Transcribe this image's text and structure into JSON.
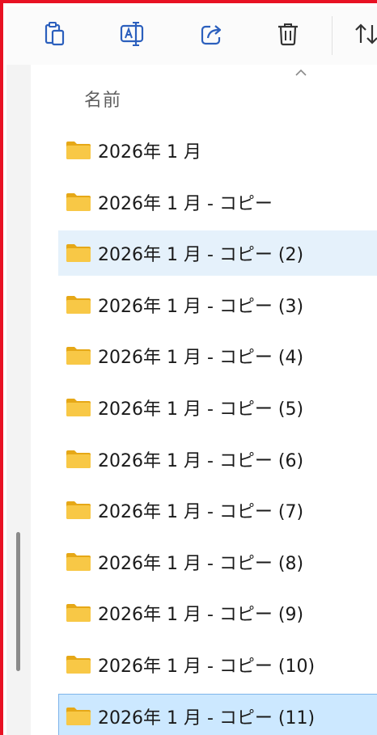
{
  "toolbar": {
    "buttons": [
      {
        "name": "paste-button",
        "icon": "clipboard-icon"
      },
      {
        "name": "rename-button",
        "icon": "rename-icon"
      },
      {
        "name": "share-button",
        "icon": "share-icon"
      },
      {
        "name": "delete-button",
        "icon": "trash-icon"
      },
      {
        "name": "sort-button",
        "icon": "sort-icon"
      }
    ]
  },
  "column_header": {
    "name_label": "名前",
    "sort_icon": "chevron-up-icon"
  },
  "files": [
    {
      "label": "2026年 1 月",
      "state": "normal"
    },
    {
      "label": "2026年 1 月 - コピー",
      "state": "normal"
    },
    {
      "label": "2026年 1 月 - コピー (2)",
      "state": "hover"
    },
    {
      "label": "2026年 1 月 - コピー (3)",
      "state": "normal"
    },
    {
      "label": "2026年 1 月 - コピー (4)",
      "state": "normal"
    },
    {
      "label": "2026年 1 月 - コピー (5)",
      "state": "normal"
    },
    {
      "label": "2026年 1 月 - コピー (6)",
      "state": "normal"
    },
    {
      "label": "2026年 1 月 - コピー (7)",
      "state": "normal"
    },
    {
      "label": "2026年 1 月 - コピー (8)",
      "state": "normal"
    },
    {
      "label": "2026年 1 月 - コピー (9)",
      "state": "normal"
    },
    {
      "label": "2026年 1 月 - コピー (10)",
      "state": "normal"
    },
    {
      "label": "2026年 1 月 - コピー (11)",
      "state": "selected"
    }
  ],
  "colors": {
    "frame_border": "#e81123",
    "folder": "#f8c846",
    "hover": "#e5f1fb",
    "selected": "#cce8ff"
  }
}
